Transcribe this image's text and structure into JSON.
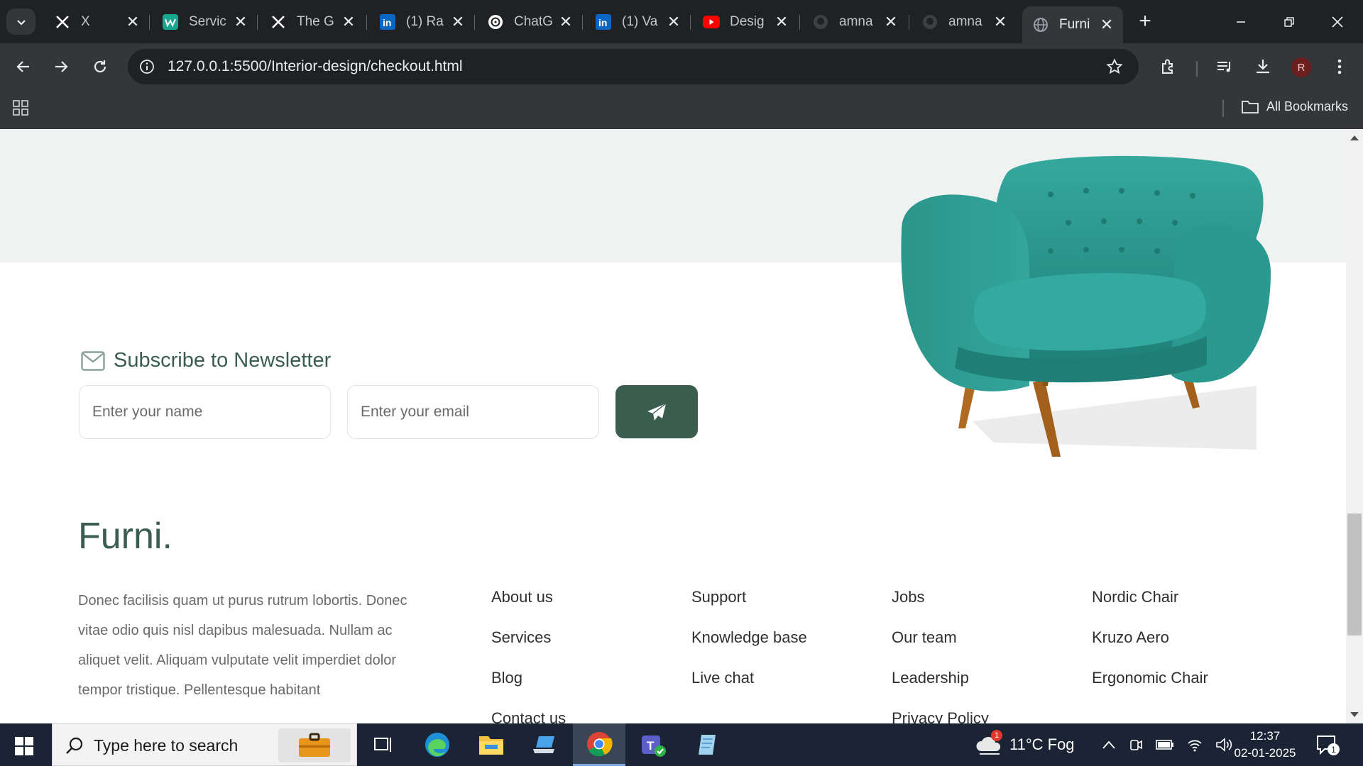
{
  "browser": {
    "tabs": [
      {
        "label": "X",
        "icon": "x-logo-icon",
        "active": false
      },
      {
        "label": "Servic",
        "icon": "webflow-icon",
        "active": false
      },
      {
        "label": "The G",
        "icon": "x-logo-icon",
        "active": false
      },
      {
        "label": "(1) Ra",
        "icon": "linkedin-icon",
        "active": false
      },
      {
        "label": "ChatG",
        "icon": "chatgpt-icon",
        "active": false
      },
      {
        "label": "(1) Va",
        "icon": "linkedin-icon",
        "active": false
      },
      {
        "label": "Desig",
        "icon": "youtube-icon",
        "active": false
      },
      {
        "label": "amna",
        "icon": "github-icon",
        "active": false
      },
      {
        "label": "amna",
        "icon": "github-icon",
        "active": false
      },
      {
        "label": "Furni",
        "icon": "globe-icon",
        "active": true
      }
    ],
    "close_glyph": "✕",
    "new_tab_glyph": "+",
    "url": "127.0.0.1:5500/Interior-design/checkout.html",
    "profile_initial": "R",
    "bookmarks_label": "All Bookmarks"
  },
  "page": {
    "newsletter": {
      "title": "Subscribe to Newsletter",
      "name_placeholder": "Enter your name",
      "email_placeholder": "Enter your email"
    },
    "footer": {
      "brand": "Furni.",
      "about": "Donec facilisis quam ut purus rutrum lobortis. Donec vitae odio quis nisl dapibus malesuada. Nullam ac aliquet velit. Aliquam vulputate velit imperdiet dolor tempor tristique. Pellentesque habitant",
      "columns": [
        [
          "About us",
          "Services",
          "Blog",
          "Contact us"
        ],
        [
          "Support",
          "Knowledge base",
          "Live chat"
        ],
        [
          "Jobs",
          "Our team",
          "Leadership",
          "Privacy Policy"
        ],
        [
          "Nordic Chair",
          "Kruzo Aero",
          "Ergonomic Chair"
        ]
      ]
    },
    "colors": {
      "brand": "#3b5d50",
      "hero_bg": "#eff2f1",
      "sofa": "#2f9f96"
    }
  },
  "taskbar": {
    "search_placeholder": "Type here to search",
    "weather": "11°C  Fog",
    "weather_badge": "1",
    "time": "12:37",
    "date": "02-01-2025",
    "notification_count": "1"
  }
}
